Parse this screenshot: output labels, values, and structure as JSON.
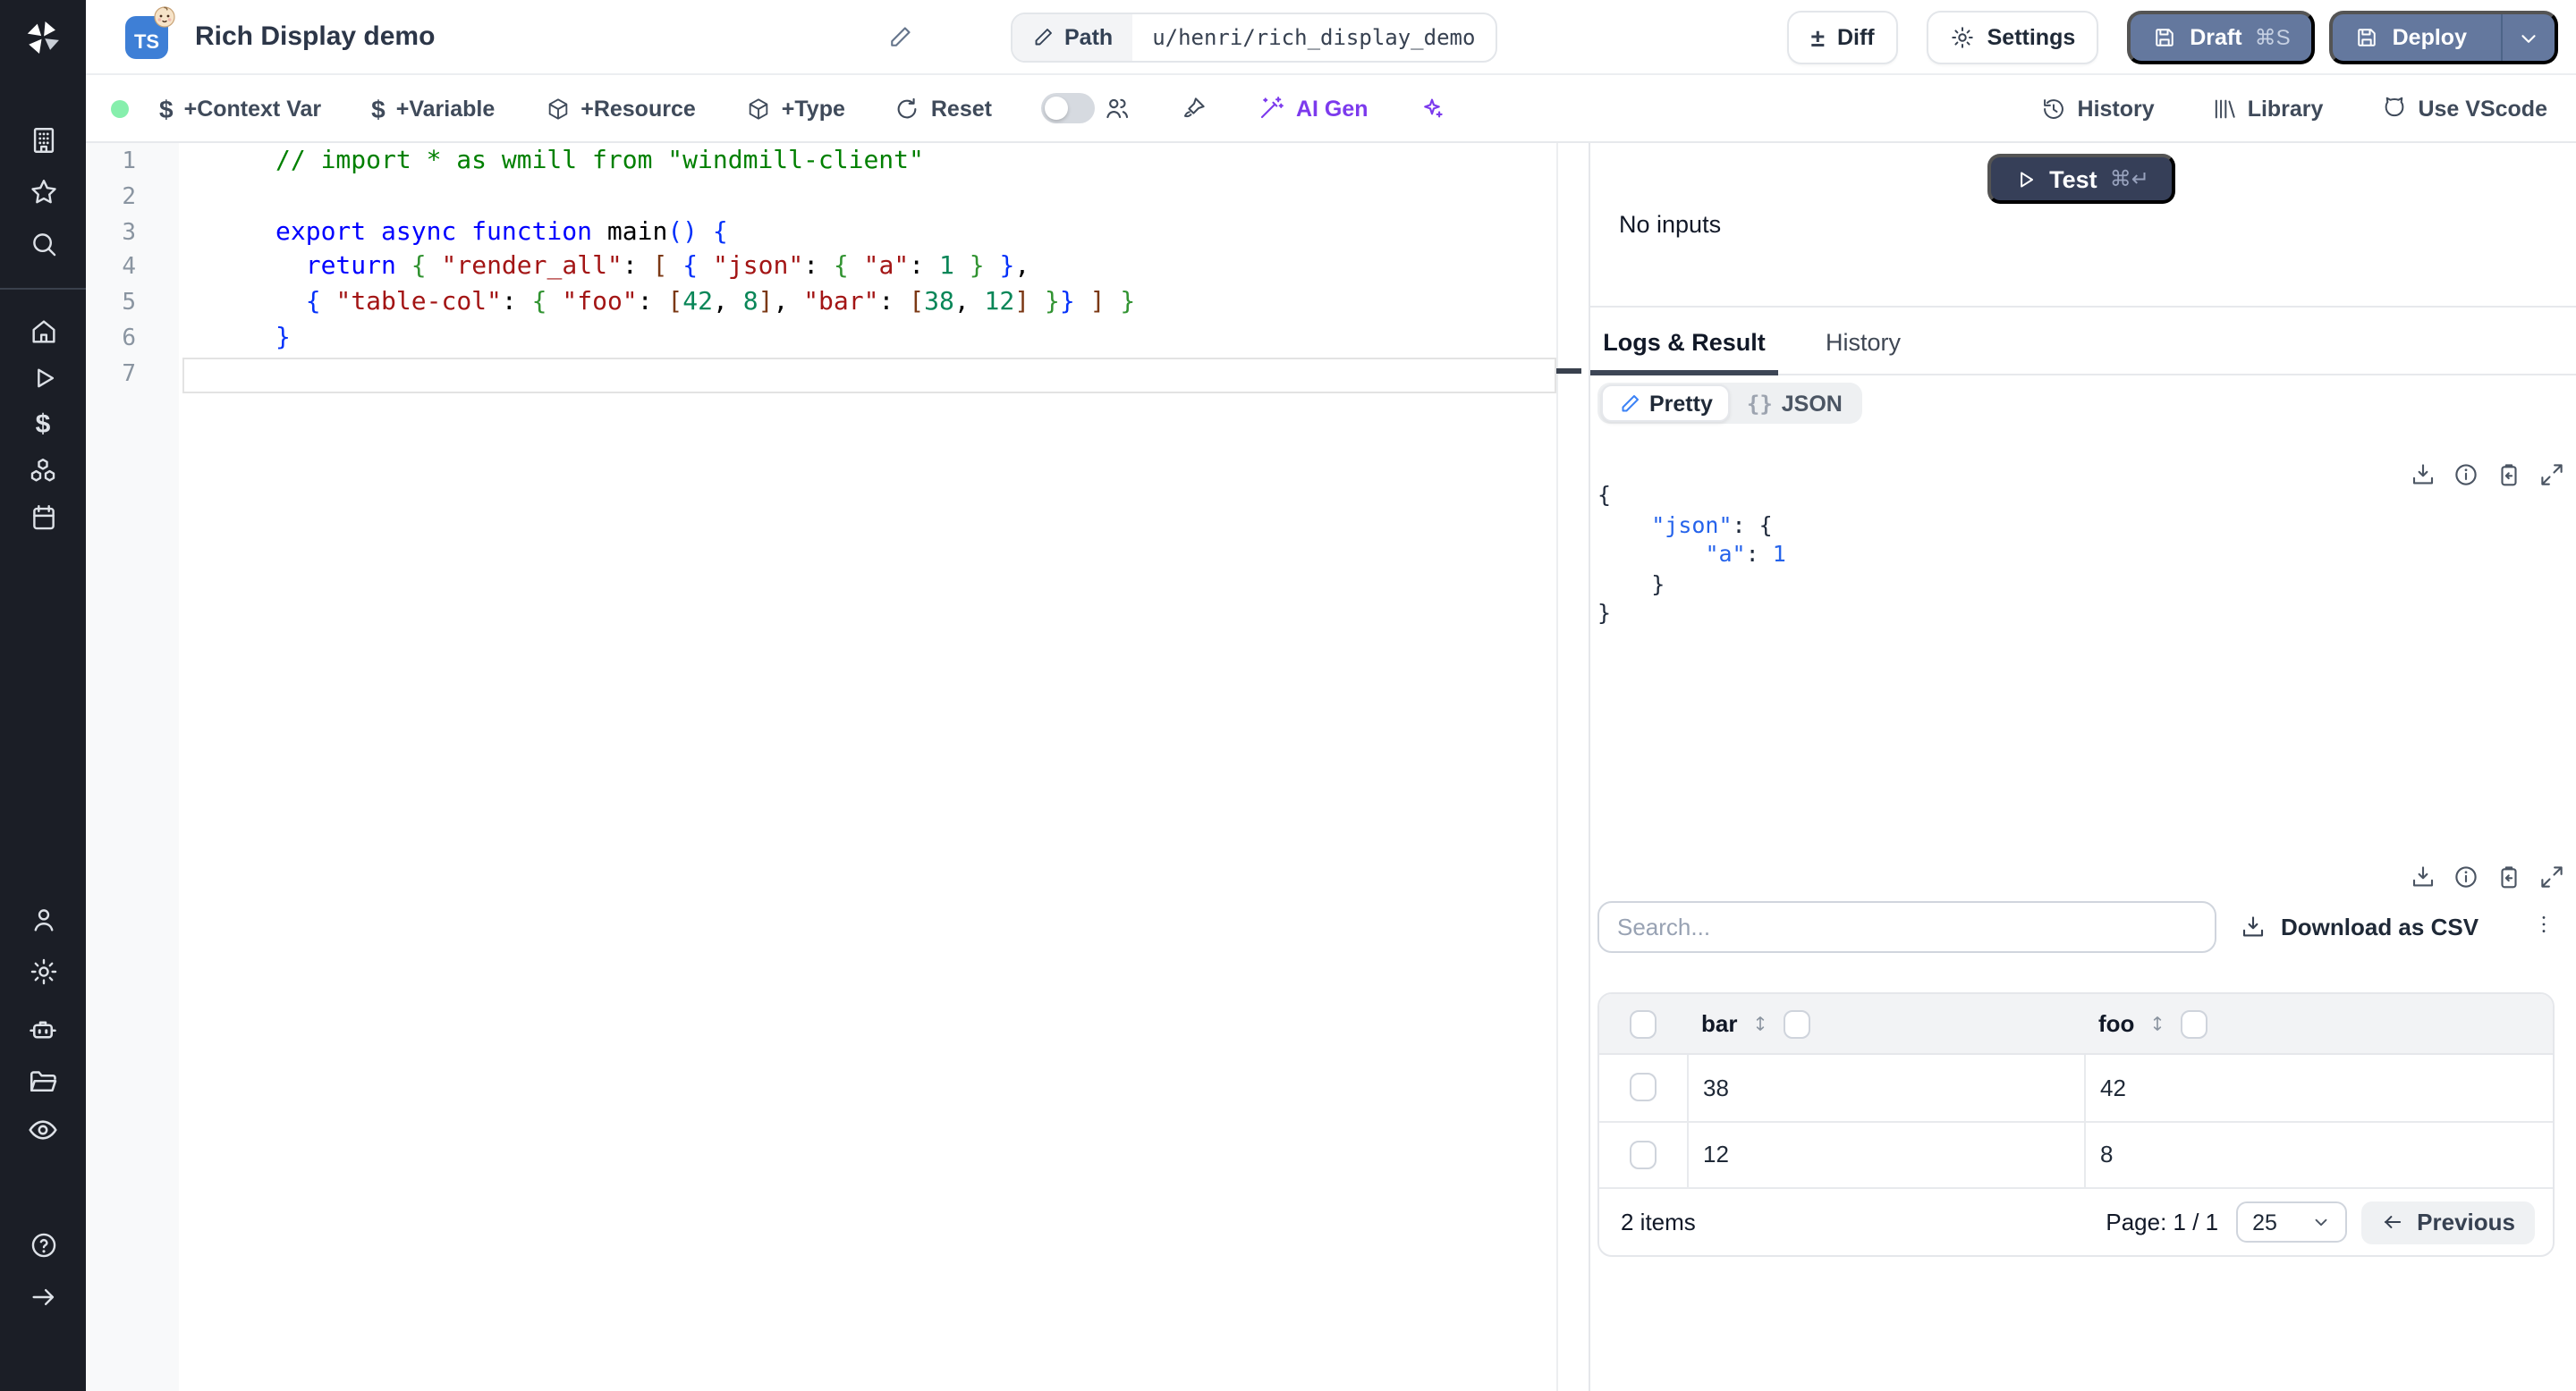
{
  "app": {
    "name": "Windmill script editor"
  },
  "topbar": {
    "language_badge": "TS",
    "title": "Rich Display demo",
    "path_label": "Path",
    "path_value": "u/henri/rich_display_demo",
    "diff_glyph": "±",
    "diff_label": "Diff",
    "settings_label": "Settings",
    "draft_label": "Draft",
    "draft_shortcut": "⌘S",
    "deploy_label": "Deploy"
  },
  "toolbar": {
    "dollar_glyph": "$",
    "add_context_var": "+Context Var",
    "add_variable": "+Variable",
    "add_resource": "+Resource",
    "add_type": "+Type",
    "reset": "Reset",
    "ai_gen": "AI Gen",
    "history": "History",
    "library": "Library",
    "use_vscode": "Use VScode"
  },
  "editor": {
    "line_numbers": [
      "1",
      "2",
      "3",
      "4",
      "5",
      "6",
      "7"
    ],
    "lines": [
      [
        [
          "cm",
          "// import * as wmill from \"windmill-client\""
        ]
      ],
      [],
      [
        [
          "kw",
          "export async function "
        ],
        [
          "pl",
          "main"
        ],
        [
          "b1",
          "() {"
        ]
      ],
      [
        [
          "pl",
          "  "
        ],
        [
          "kw",
          "return"
        ],
        [
          "pl",
          " "
        ],
        [
          "b2",
          "{"
        ],
        [
          "pl",
          " "
        ],
        [
          "str",
          "\"render_all\""
        ],
        [
          "pl",
          ": "
        ],
        [
          "b3",
          "["
        ],
        [
          "pl",
          " "
        ],
        [
          "b1",
          "{"
        ],
        [
          "pl",
          " "
        ],
        [
          "str",
          "\"json\""
        ],
        [
          "pl",
          ": "
        ],
        [
          "b2",
          "{"
        ],
        [
          "pl",
          " "
        ],
        [
          "str",
          "\"a\""
        ],
        [
          "pl",
          ": "
        ],
        [
          "num",
          "1"
        ],
        [
          "pl",
          " "
        ],
        [
          "b2",
          "}"
        ],
        [
          "pl",
          " "
        ],
        [
          "b1",
          "}"
        ],
        [
          "pl",
          ","
        ]
      ],
      [
        [
          "pl",
          "  "
        ],
        [
          "b1",
          "{"
        ],
        [
          "pl",
          " "
        ],
        [
          "str",
          "\"table-col\""
        ],
        [
          "pl",
          ": "
        ],
        [
          "b2",
          "{"
        ],
        [
          "pl",
          " "
        ],
        [
          "str",
          "\"foo\""
        ],
        [
          "pl",
          ": "
        ],
        [
          "b3",
          "["
        ],
        [
          "num",
          "42"
        ],
        [
          "pl",
          ", "
        ],
        [
          "num",
          "8"
        ],
        [
          "b3",
          "]"
        ],
        [
          "pl",
          ", "
        ],
        [
          "str",
          "\"bar\""
        ],
        [
          "pl",
          ": "
        ],
        [
          "b3",
          "["
        ],
        [
          "num",
          "38"
        ],
        [
          "pl",
          ", "
        ],
        [
          "num",
          "12"
        ],
        [
          "b3",
          "]"
        ],
        [
          "pl",
          " "
        ],
        [
          "b2",
          "}"
        ],
        [
          "b1",
          "}"
        ],
        [
          "pl",
          " "
        ],
        [
          "b3",
          "]"
        ],
        [
          "pl",
          " "
        ],
        [
          "b2",
          "}"
        ]
      ],
      [
        [
          "b1",
          "}"
        ]
      ],
      []
    ],
    "active_line": "7"
  },
  "run_panel": {
    "test_label": "Test",
    "test_shortcut": "⌘↵",
    "no_inputs": "No inputs",
    "tabs": {
      "logs": "Logs & Result",
      "history": "History"
    },
    "result_view": {
      "pretty": "Pretty",
      "json": "JSON",
      "braces_glyph": "{}"
    },
    "result_lines": [
      [
        [
          "p",
          "{"
        ]
      ],
      [
        [
          "p",
          "    "
        ],
        [
          "k",
          "\"json\""
        ],
        [
          "p",
          ": {"
        ]
      ],
      [
        [
          "p",
          "        "
        ],
        [
          "k",
          "\"a\""
        ],
        [
          "p",
          ": "
        ],
        [
          "v",
          "1"
        ]
      ],
      [
        [
          "p",
          "    }"
        ]
      ],
      [
        [
          "p",
          "}"
        ]
      ]
    ]
  },
  "result_table": {
    "search_placeholder": "Search...",
    "download_csv": "Download as CSV",
    "columns": [
      "bar",
      "foo"
    ],
    "rows": [
      [
        "38",
        "42"
      ],
      [
        "12",
        "8"
      ]
    ],
    "items_count": "2 items",
    "page_label": "Page: 1 / 1",
    "page_size": "25",
    "previous": "Previous"
  },
  "colors": {
    "sidebar_bg": "#1b1e26",
    "slate_button": "#64789e",
    "test_button": "#363f58",
    "badge_blue": "#3e7fd6",
    "ai_purple": "#7c3aed",
    "status_green": "#86efac",
    "tab_underline": "#3d4656",
    "code_keyword": "#0000ff",
    "code_string": "#a31515",
    "code_number": "#098658",
    "code_comment": "#008000",
    "result_key_blue": "#2563eb"
  }
}
